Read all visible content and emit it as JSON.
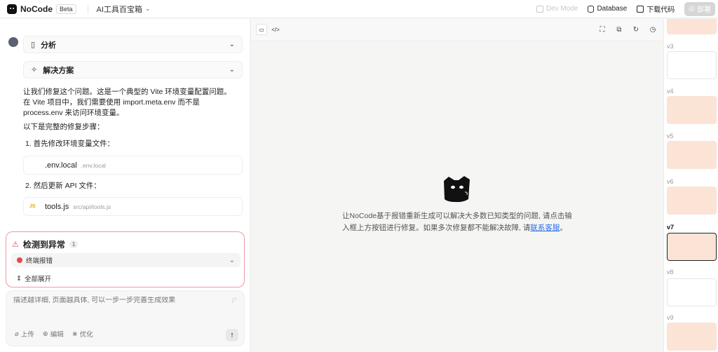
{
  "header": {
    "brand": "NoCode",
    "badge": "Beta",
    "project": "AI工具百宝箱",
    "dev_mode": "Dev Mode",
    "database": "Database",
    "download": "下载代码",
    "deploy": "部署"
  },
  "chat": {
    "sections": [
      {
        "label": "分析",
        "icon": "clipboard-icon"
      },
      {
        "label": "解决方案",
        "icon": "sparkle-icon"
      }
    ],
    "intro": "让我们修复这个问题。这是一个典型的 Vite 环境变量配置问题。在 Vite 项目中，我们需要使用 import.meta.env 而不是 process.env 来访问环境变量。",
    "steps_intro": "以下是完整的修复步骤：",
    "step1": "1. 首先修改环境变量文件：",
    "file1": {
      "name": ".env.local",
      "path": ".env.local"
    },
    "step2": "2. 然后更新 API 文件：",
    "file2": {
      "badge": "JS",
      "name": "tools.js",
      "path": "src/api/tools.js"
    }
  },
  "alert": {
    "title": "检测到异常",
    "count": "1",
    "row_label": "终端报错",
    "expand_all": "全部展开"
  },
  "composer": {
    "placeholder": "描述越详细, 页面越具体, 可以一步一步完善生成效果",
    "upload": "上传",
    "edit": "编辑",
    "optimize": "优化"
  },
  "preview": {
    "message_part1": "让NoCode基于报错重新生成可以解决大多数已知类型的问题, 请点击输入框上方按钮进行修复。如果多次修复都不能解决故障, 请",
    "message_link": "联系客服",
    "message_end": "。"
  },
  "versions": {
    "v3": "v3",
    "v4": "v4",
    "v5": "v5",
    "v6": "v6",
    "v7": "v7",
    "v8": "v8",
    "v9": "v9",
    "selected": "v7"
  },
  "colors": {
    "accent_link": "#2f6ee8",
    "error": "#e5484d",
    "thumb_peach": "#fbe3d6"
  }
}
